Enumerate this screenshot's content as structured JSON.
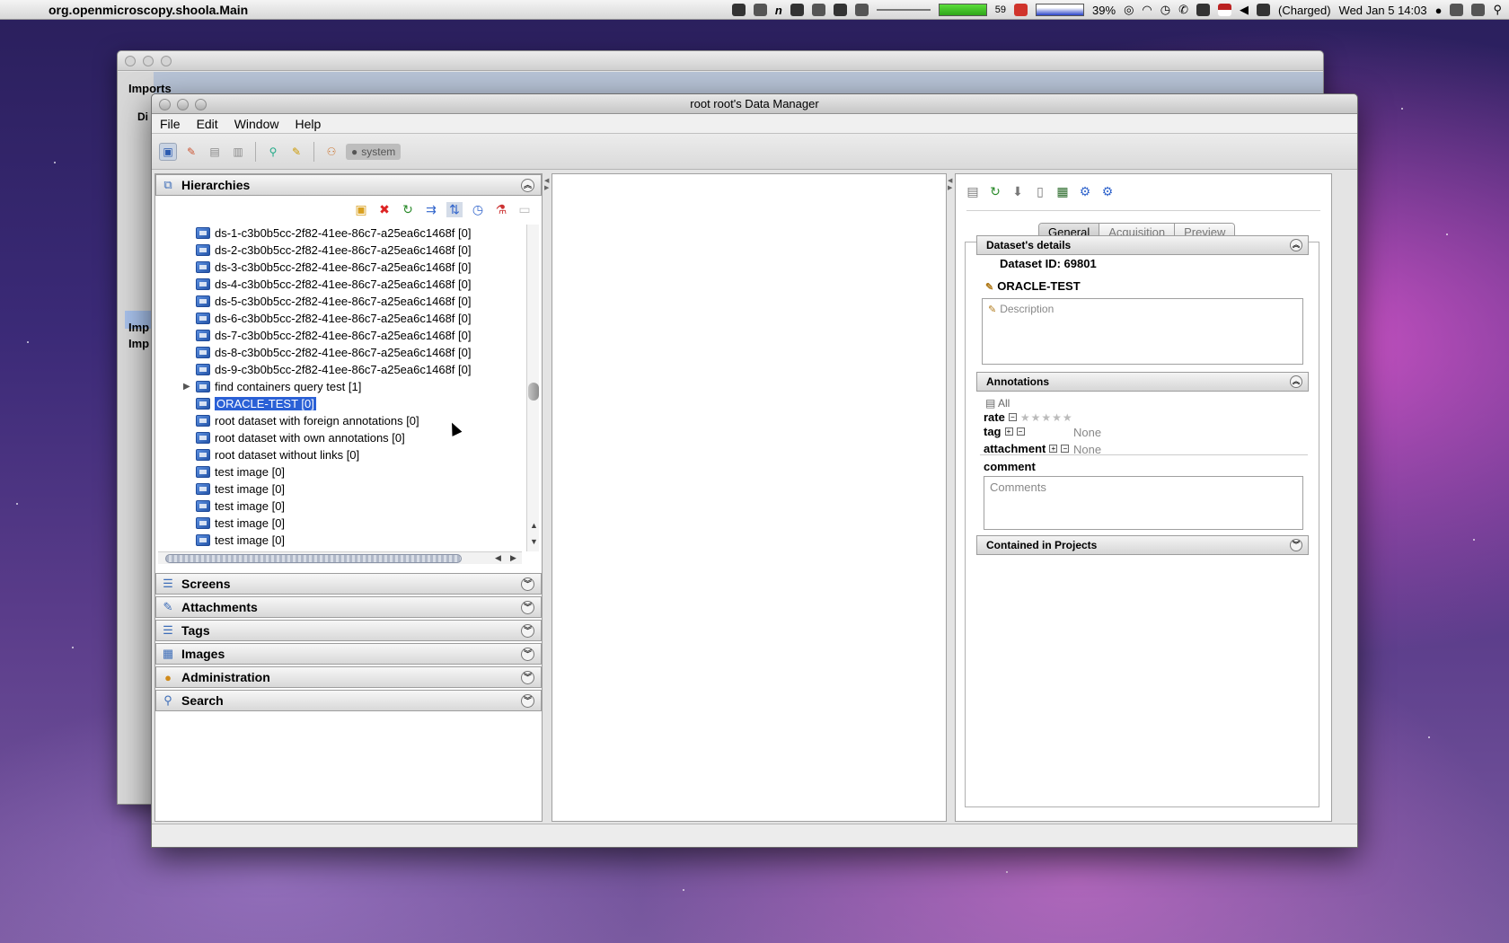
{
  "menubar": {
    "app_name": "org.openmicroscopy.shoola.Main",
    "cpu_count": "59",
    "battery_percent": "39%",
    "power_status": "(Charged)",
    "clock": "Wed Jan 5  14:03"
  },
  "background_window": {
    "title": "Imports",
    "sub_label": "Di",
    "item1": "Imp",
    "item2": "Imp"
  },
  "window": {
    "title": "root root's Data Manager",
    "menu": [
      "File",
      "Edit",
      "Window",
      "Help"
    ],
    "toolbar": {
      "group_label": "system"
    }
  },
  "left_panel": {
    "hierarchies_label": "Hierarchies",
    "tree": [
      {
        "label": "ds-1-c3b0b5cc-2f82-41ee-86c7-a25ea6c1468f [0]"
      },
      {
        "label": "ds-2-c3b0b5cc-2f82-41ee-86c7-a25ea6c1468f [0]"
      },
      {
        "label": "ds-3-c3b0b5cc-2f82-41ee-86c7-a25ea6c1468f [0]"
      },
      {
        "label": "ds-4-c3b0b5cc-2f82-41ee-86c7-a25ea6c1468f [0]"
      },
      {
        "label": "ds-5-c3b0b5cc-2f82-41ee-86c7-a25ea6c1468f [0]"
      },
      {
        "label": "ds-6-c3b0b5cc-2f82-41ee-86c7-a25ea6c1468f [0]"
      },
      {
        "label": "ds-7-c3b0b5cc-2f82-41ee-86c7-a25ea6c1468f [0]"
      },
      {
        "label": "ds-8-c3b0b5cc-2f82-41ee-86c7-a25ea6c1468f [0]"
      },
      {
        "label": "ds-9-c3b0b5cc-2f82-41ee-86c7-a25ea6c1468f [0]"
      },
      {
        "label": "find containers query test [1]",
        "expandable": true
      },
      {
        "label": "ORACLE-TEST [0]",
        "selected": true
      },
      {
        "label": "root dataset with foreign annotations [0]"
      },
      {
        "label": "root dataset with own annotations [0]"
      },
      {
        "label": "root dataset without links [0]"
      },
      {
        "label": "test image [0]"
      },
      {
        "label": "test image [0]"
      },
      {
        "label": "test image [0]"
      },
      {
        "label": "test image [0]"
      },
      {
        "label": "test image [0]"
      }
    ],
    "sections": [
      "Screens",
      "Attachments",
      "Tags",
      "Images",
      "Administration",
      "Search"
    ]
  },
  "right_panel": {
    "tabs": [
      "General",
      "Acquisition",
      "Preview"
    ],
    "active_tab": "General",
    "details_header": "Dataset's details",
    "dataset_id": "Dataset ID: 69801",
    "dataset_name": "ORACLE-TEST",
    "description_placeholder": "Description",
    "annotations_header": "Annotations",
    "annotations_filter": "All",
    "rate_label": "rate",
    "tag_label": "tag",
    "tag_value": "None",
    "attachment_label": "attachment",
    "attachment_value": "None",
    "comment_label": "comment",
    "comment_placeholder": "Comments",
    "projects_header": "Contained in Projects"
  }
}
